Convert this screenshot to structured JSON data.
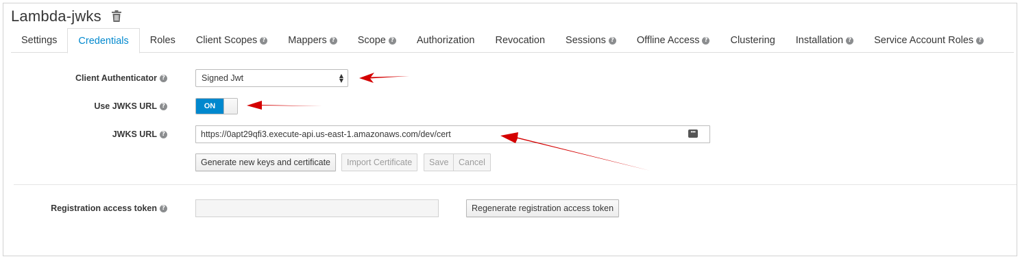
{
  "client": {
    "name": "Lambda-jwks"
  },
  "tabs": [
    {
      "label": "Settings",
      "help": false,
      "active": false
    },
    {
      "label": "Credentials",
      "help": false,
      "active": true
    },
    {
      "label": "Roles",
      "help": false,
      "active": false
    },
    {
      "label": "Client Scopes",
      "help": true,
      "active": false
    },
    {
      "label": "Mappers",
      "help": true,
      "active": false
    },
    {
      "label": "Scope",
      "help": true,
      "active": false
    },
    {
      "label": "Authorization",
      "help": false,
      "active": false
    },
    {
      "label": "Revocation",
      "help": false,
      "active": false
    },
    {
      "label": "Sessions",
      "help": true,
      "active": false
    },
    {
      "label": "Offline Access",
      "help": true,
      "active": false
    },
    {
      "label": "Clustering",
      "help": false,
      "active": false
    },
    {
      "label": "Installation",
      "help": true,
      "active": false
    },
    {
      "label": "Service Account Roles",
      "help": true,
      "active": false
    }
  ],
  "form": {
    "client_authenticator": {
      "label": "Client Authenticator",
      "value": "Signed Jwt"
    },
    "use_jwks_url": {
      "label": "Use JWKS URL",
      "value": "ON"
    },
    "jwks_url": {
      "label": "JWKS URL",
      "value": "https://0apt29qfi3.execute-api.us-east-1.amazonaws.com/dev/cert"
    }
  },
  "buttons": {
    "generate": "Generate new keys and certificate",
    "import": "Import Certificate",
    "save": "Save",
    "cancel": "Cancel",
    "regenerate": "Regenerate registration access token"
  },
  "registration": {
    "label": "Registration access token",
    "value": ""
  },
  "colors": {
    "accent": "#0088ce",
    "arrow": "#d40000"
  }
}
